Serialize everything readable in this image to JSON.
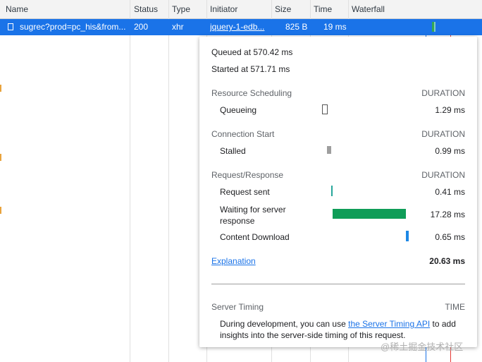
{
  "columns": [
    "Name",
    "Status",
    "Type",
    "Initiator",
    "Size",
    "Time",
    "Waterfall"
  ],
  "request": {
    "name": "sugrec?prod=pc_his&from...",
    "status": "200",
    "type": "xhr",
    "initiator": "jquery-1-edb...",
    "size": "825 B",
    "time": "19 ms"
  },
  "timing": {
    "queued_at": "Queued at 570.42 ms",
    "started_at": "Started at 571.71 ms",
    "duration_label": "DURATION",
    "sections": [
      {
        "title": "Resource Scheduling",
        "rows": [
          {
            "label": "Queueing",
            "value": "1.29 ms"
          }
        ]
      },
      {
        "title": "Connection Start",
        "rows": [
          {
            "label": "Stalled",
            "value": "0.99 ms"
          }
        ]
      },
      {
        "title": "Request/Response",
        "rows": [
          {
            "label": "Request sent",
            "value": "0.41 ms"
          },
          {
            "label": "Waiting for server response",
            "value": "17.28 ms"
          },
          {
            "label": "Content Download",
            "value": "0.65 ms"
          }
        ]
      }
    ],
    "explanation_link": "Explanation",
    "total": "20.63 ms",
    "server_timing": {
      "title": "Server Timing",
      "time_label": "TIME",
      "desc_before": "During development, you can use ",
      "desc_link": "the Server Timing API",
      "desc_after": " to add insights into the server-side timing of this request."
    }
  },
  "colors": {
    "selected_row": "#1a73e8",
    "waiting_bar": "#0f9d58",
    "download_bar": "#1e88e5",
    "stalled_bar": "#9e9e9e",
    "request_sent_bar": "#26a69a"
  },
  "watermark": "@稀土掘金技术社区"
}
